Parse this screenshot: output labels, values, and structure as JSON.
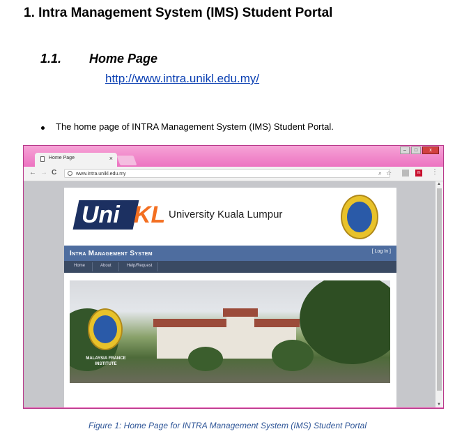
{
  "document": {
    "heading": "1. Intra Management System (IMS) Student Portal",
    "section_number": "1.1.",
    "section_title": "Home Page",
    "link": "http://www.intra.unikl.edu.my/",
    "bullet": "The home page of INTRA Management System (IMS) Student Portal.",
    "caption": "Figure 1: Home Page for INTRA Management System (IMS) Student Portal"
  },
  "browser": {
    "tab_title": "Home Page",
    "tab_close": "×",
    "url": "www.intra.unikl.edu.my",
    "back": "←",
    "forward": "→",
    "reload": "C",
    "zoom_icon": "⌕",
    "star_icon": "☆",
    "menu_icon": "⋮",
    "extension_label": "m",
    "win_min": "–",
    "win_max": "□",
    "win_close": "x"
  },
  "site": {
    "logo_uni": "Uni",
    "logo_kl": "KL",
    "logo_name": "University Kuala Lumpur",
    "system_title": "Intra Management System",
    "login": "[ Log In ]",
    "nav": [
      "Home",
      "About",
      "Help/Request"
    ],
    "photo_caption_line1": "MALAYSIA FRANCE",
    "photo_caption_line2": "INSTITUTE"
  },
  "colors": {
    "brand_navy": "#1c3061",
    "brand_orange": "#f36f21",
    "ims_bar": "#4e6d9f",
    "ims_nav": "#3a4a63",
    "browser_frame": "#e957b4",
    "caption_blue": "#2e5597"
  }
}
